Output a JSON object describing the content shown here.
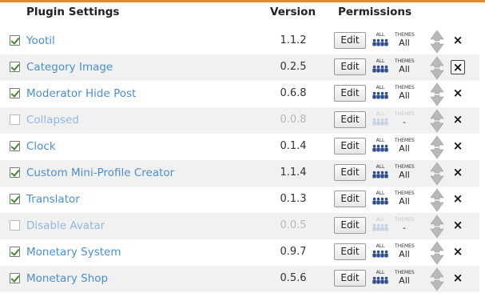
{
  "header": {
    "plugin_settings": "Plugin Settings",
    "version": "Version",
    "permissions": "Permissions"
  },
  "accent_color": "#e58b2a",
  "link_color": "#4a8fd4",
  "plugins": [
    {
      "name": "Yootil",
      "version": "1.1.2",
      "enabled": true,
      "edit": "Edit",
      "all_label": "ALL",
      "themes_label": "THEMES",
      "themes_value": "All"
    },
    {
      "name": "Category Image",
      "version": "0.2.5",
      "enabled": true,
      "edit": "Edit",
      "all_label": "ALL",
      "themes_label": "THEMES",
      "themes_value": "All"
    },
    {
      "name": "Moderator Hide Post",
      "version": "0.6.8",
      "enabled": true,
      "edit": "Edit",
      "all_label": "ALL",
      "themes_label": "THEMES",
      "themes_value": "All"
    },
    {
      "name": "Collapsed",
      "version": "0.0.8",
      "enabled": false,
      "edit": "Edit",
      "all_label": "ALL",
      "themes_label": "THEMES",
      "themes_value": "-"
    },
    {
      "name": "Clock",
      "version": "0.1.4",
      "enabled": true,
      "edit": "Edit",
      "all_label": "ALL",
      "themes_label": "THEMES",
      "themes_value": "All"
    },
    {
      "name": "Custom Mini-Profile Creator",
      "version": "1.1.4",
      "enabled": true,
      "edit": "Edit",
      "all_label": "ALL",
      "themes_label": "THEMES",
      "themes_value": "All"
    },
    {
      "name": "Translator",
      "version": "0.1.3",
      "enabled": true,
      "edit": "Edit",
      "all_label": "ALL",
      "themes_label": "THEMES",
      "themes_value": "All"
    },
    {
      "name": "Disable Avatar",
      "version": "0.0.5",
      "enabled": false,
      "edit": "Edit",
      "all_label": "ALL",
      "themes_label": "THEMES",
      "themes_value": "-"
    },
    {
      "name": "Monetary System",
      "version": "0.9.7",
      "enabled": true,
      "edit": "Edit",
      "all_label": "ALL",
      "themes_label": "THEMES",
      "themes_value": "All"
    },
    {
      "name": "Monetary Shop",
      "version": "0.5.6",
      "enabled": true,
      "edit": "Edit",
      "all_label": "ALL",
      "themes_label": "THEMES",
      "themes_value": "All"
    }
  ],
  "icons": {
    "checkbox": "checkbox-icon",
    "group": "user-group-icon",
    "reorder": "reorder-arrows-icon",
    "delete": "delete-x-icon"
  }
}
